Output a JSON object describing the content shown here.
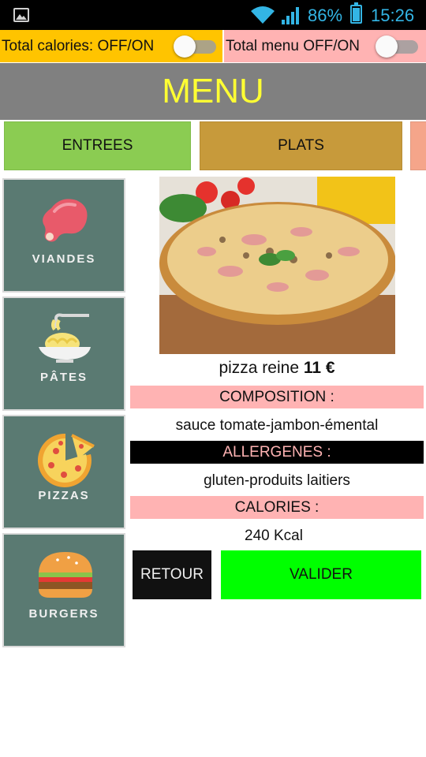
{
  "status_bar": {
    "battery_percent": "86%",
    "time": "15:26",
    "icons": [
      "image-icon",
      "wifi-icon",
      "signal-icon",
      "battery-icon"
    ]
  },
  "toggles": {
    "total_calories_label": "Total calories: OFF/ON",
    "total_menu_label": "Total menu OFF/ON"
  },
  "header": {
    "title": "MENU"
  },
  "tabs": [
    {
      "label": "ENTREES"
    },
    {
      "label": "PLATS"
    },
    {
      "label": ""
    }
  ],
  "sidebar": {
    "items": [
      {
        "label": "VIANDES",
        "icon": "meat-icon"
      },
      {
        "label": "PÂTES",
        "icon": "pasta-icon"
      },
      {
        "label": "PIZZAS",
        "icon": "pizza-icon"
      },
      {
        "label": "BURGERS",
        "icon": "burger-icon"
      }
    ]
  },
  "dish": {
    "name": "pizza  reine",
    "price": "11 €",
    "composition_header": "COMPOSITION :",
    "composition": "sauce tomate-jambon-émental",
    "allergens_header": "ALLERGENES :",
    "allergens": "gluten-produits laitiers",
    "calories_header": "CALORIES :",
    "calories": "240 Kcal"
  },
  "actions": {
    "back_label": "RETOUR",
    "confirm_label": "VALIDER"
  },
  "colors": {
    "calories_toggle_bg": "#ffc400",
    "menu_toggle_bg": "#ffb3b3",
    "title_bg": "#808080",
    "title_text": "#ffff33",
    "tab_entrees": "#8bcc52",
    "tab_plats": "#c79a3b",
    "sidebar_bg": "#5a7a72",
    "confirm_bg": "#00ff00",
    "status_accent": "#33b5e5"
  }
}
